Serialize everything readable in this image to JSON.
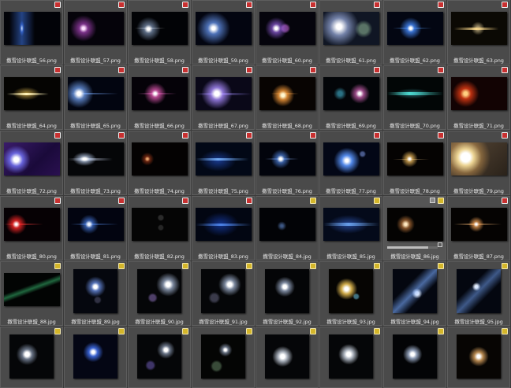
{
  "window": {
    "title": ""
  },
  "items": [
    {
      "name": "撒雪设计联盟_56.png",
      "type": "png",
      "effect": "flare-blue-thin"
    },
    {
      "name": "撒雪设计联盟_57.png",
      "type": "png",
      "effect": "flare-purple"
    },
    {
      "name": "撒雪设计联盟_58.png",
      "type": "png",
      "effect": "flare-white-star"
    },
    {
      "name": "撒雪设计联盟_59.png",
      "type": "png",
      "effect": "flare-blue-glow"
    },
    {
      "name": "撒雪设计联盟_60.png",
      "type": "png",
      "effect": "flare-purple-orb"
    },
    {
      "name": "撒雪设计联盟_61.png",
      "type": "png",
      "effect": "flare-white-haze"
    },
    {
      "name": "撒雪设计联盟_62.png",
      "type": "png",
      "effect": "flare-blue-star"
    },
    {
      "name": "撒雪设计联盟_63.png",
      "type": "png",
      "effect": "flare-gold-streak"
    },
    {
      "name": "撒雪设计联盟_64.png",
      "type": "png",
      "effect": "flare-gold-line"
    },
    {
      "name": "撒雪设计联盟_65.png",
      "type": "png",
      "effect": "flare-blue-line"
    },
    {
      "name": "撒雪设计联盟_66.png",
      "type": "png",
      "effect": "flare-pink-star"
    },
    {
      "name": "撒雪设计联盟_67.png",
      "type": "png",
      "effect": "flare-violet-bright"
    },
    {
      "name": "撒雪设计联盟_68.png",
      "type": "png",
      "effect": "flare-orange-star"
    },
    {
      "name": "撒雪设计联盟_69.png",
      "type": "png",
      "effect": "flare-cyan-pink"
    },
    {
      "name": "撒雪设计联盟_70.png",
      "type": "png",
      "effect": "flare-teal-line"
    },
    {
      "name": "撒雪设计联盟_71.png",
      "type": "png",
      "effect": "flare-red-orb"
    },
    {
      "name": "撒雪设计联盟_72.png",
      "type": "png",
      "effect": "flare-violet-bg"
    },
    {
      "name": "撒雪设计联盟_73.png",
      "type": "png",
      "effect": "flare-white-wide"
    },
    {
      "name": "撒雪设计联盟_74.png",
      "type": "png",
      "effect": "flare-dim-orange"
    },
    {
      "name": "撒雪设计联盟_75.png",
      "type": "png",
      "effect": "flare-blue-wide"
    },
    {
      "name": "撒雪设计联盟_76.png",
      "type": "png",
      "effect": "flare-blue-cross"
    },
    {
      "name": "撒雪设计联盟_77.png",
      "type": "png",
      "effect": "flare-blue-star-big"
    },
    {
      "name": "撒雪设计联盟_78.png",
      "type": "png",
      "effect": "flare-gold-star"
    },
    {
      "name": "撒雪设计联盟_79.png",
      "type": "png",
      "effect": "flare-sun"
    },
    {
      "name": "撒雪设计联盟_80.png",
      "type": "png",
      "effect": "flare-red-line"
    },
    {
      "name": "撒雪设计联盟_81.png",
      "type": "png",
      "effect": "flare-blue-thin2"
    },
    {
      "name": "撒雪设计联盟_82.png",
      "type": "png",
      "effect": "flare-dark-orbs"
    },
    {
      "name": "撒雪设计联盟_83.png",
      "type": "png",
      "effect": "flare-blue-streaks"
    },
    {
      "name": "撒雪设计联盟_84.jpg",
      "type": "jpg",
      "effect": "flare-faint-blue"
    },
    {
      "name": "撒雪设计联盟_85.jpg",
      "type": "jpg",
      "effect": "flare-blue-haze"
    },
    {
      "name": "撒雪设计联盟_86.jpg",
      "type": "jpg",
      "effect": "flare-small-star",
      "selected": true,
      "progress": 0.82
    },
    {
      "name": "撒雪设计联盟_87.png",
      "type": "png",
      "effect": "flare-amber-line"
    },
    {
      "name": "撒雪设计联盟_88.jpg",
      "type": "jpg",
      "effect": "flare-green-faint"
    },
    {
      "name": "撒雪设计联盟_89.jpg",
      "type": "jpg",
      "effect": "sq-blue-star"
    },
    {
      "name": "撒雪设计联盟_90.jpg",
      "type": "jpg",
      "effect": "sq-white-star"
    },
    {
      "name": "撒雪设计联盟_91.jpg",
      "type": "jpg",
      "effect": "sq-white-star2"
    },
    {
      "name": "撒雪设计联盟_92.jpg",
      "type": "jpg",
      "effect": "sq-white-star3"
    },
    {
      "name": "撒雪设计联盟_93.jpg",
      "type": "jpg",
      "effect": "sq-gold-star"
    },
    {
      "name": "撒雪设计联盟_94.jpg",
      "type": "jpg",
      "effect": "sq-blue-diag"
    },
    {
      "name": "撒雪设计联盟_95.jpg",
      "type": "jpg",
      "effect": "sq-blue-diag2"
    },
    {
      "name": "",
      "type": "jpg",
      "effect": "sq-white-flare"
    },
    {
      "name": "",
      "type": "jpg",
      "effect": "sq-blue-center"
    },
    {
      "name": "",
      "type": "jpg",
      "effect": "sq-white-small"
    },
    {
      "name": "",
      "type": "jpg",
      "effect": "sq-green-orb"
    },
    {
      "name": "",
      "type": "jpg",
      "effect": "sq-white-big"
    },
    {
      "name": "",
      "type": "jpg",
      "effect": "sq-white-big2"
    },
    {
      "name": "",
      "type": "jpg",
      "effect": "sq-white-star-sharp"
    },
    {
      "name": "",
      "type": "jpg",
      "effect": "sq-warm-glow"
    }
  ],
  "colors": {
    "background": "#3b3b3b",
    "cell": "#4a4a4a",
    "png_badge": "#c83030",
    "jpg_badge": "#d4b62a"
  }
}
